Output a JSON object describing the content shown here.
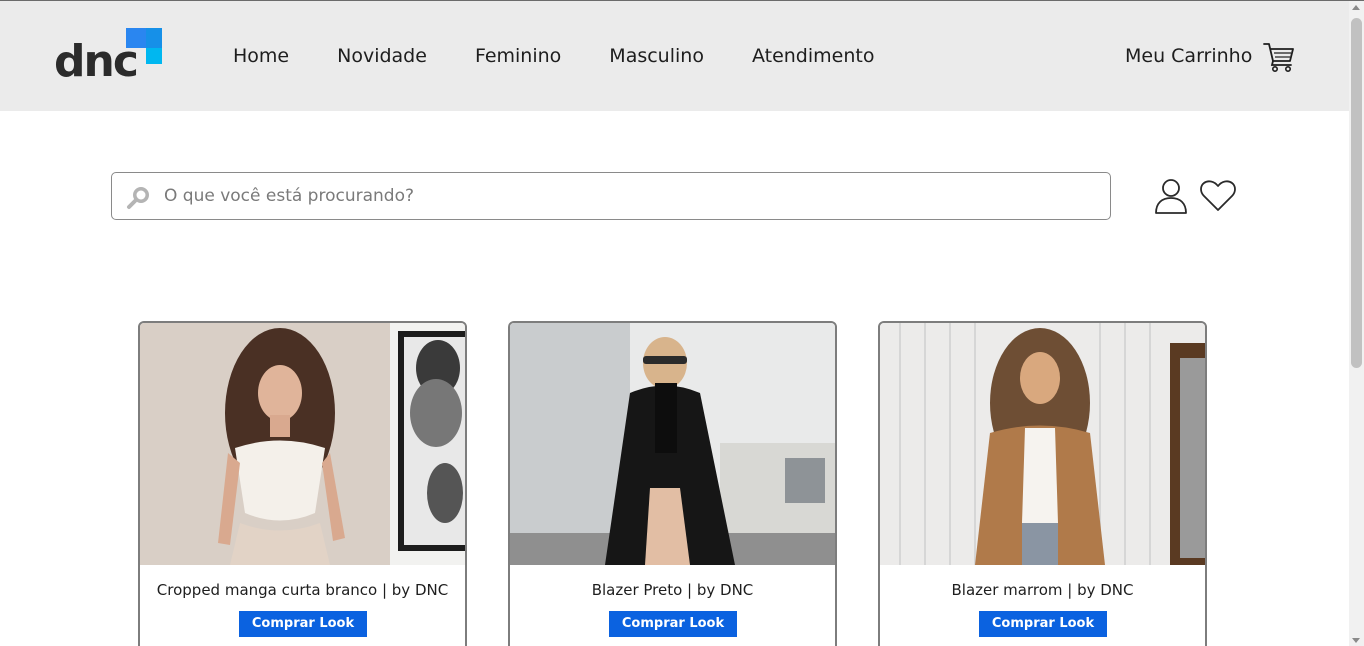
{
  "header": {
    "logo_text": "dnc",
    "nav": [
      {
        "label": "Home"
      },
      {
        "label": "Novidade"
      },
      {
        "label": "Feminino"
      },
      {
        "label": "Masculino"
      },
      {
        "label": "Atendimento"
      }
    ],
    "cart_label": "Meu Carrinho"
  },
  "search": {
    "placeholder": "O que você está procurando?",
    "value": ""
  },
  "icons": {
    "search": "search-icon",
    "user": "user-icon",
    "favorites": "heart-icon",
    "cart": "cart-icon"
  },
  "products": [
    {
      "title": "Cropped manga curta branco | by DNC",
      "button": "Comprar Look"
    },
    {
      "title": "Blazer Preto | by DNC",
      "button": "Comprar Look"
    },
    {
      "title": "Blazer marrom | by DNC",
      "button": "Comprar Look"
    }
  ],
  "colors": {
    "header_bg": "#ebebeb",
    "accent": "#0b62e0",
    "logo_blue": "#2a86f0"
  }
}
